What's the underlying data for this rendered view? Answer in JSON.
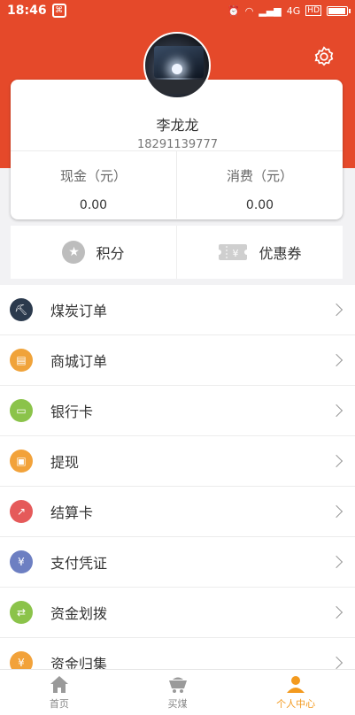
{
  "status_bar": {
    "time": "18:46",
    "network": "4G",
    "hd": "HD"
  },
  "profile": {
    "name": "李龙龙",
    "phone": "18291139777"
  },
  "stats": [
    {
      "label": "现金（元）",
      "value": "0.00"
    },
    {
      "label": "消费（元）",
      "value": "0.00"
    }
  ],
  "actions": [
    {
      "label": "积分",
      "icon": "star-icon"
    },
    {
      "label": "优惠券",
      "icon": "coupon-icon"
    }
  ],
  "menu": [
    {
      "label": "煤炭订单",
      "icon": "coal-order-icon",
      "color": "#2b3a4d"
    },
    {
      "label": "商城订单",
      "icon": "mall-order-icon",
      "color": "#f0a33a"
    },
    {
      "label": "银行卡",
      "icon": "bank-card-icon",
      "color": "#8bc34a"
    },
    {
      "label": "提现",
      "icon": "withdraw-icon",
      "color": "#f2a23a"
    },
    {
      "label": "结算卡",
      "icon": "settlement-card-icon",
      "color": "#e55a5a"
    },
    {
      "label": "支付凭证",
      "icon": "payment-voucher-icon",
      "color": "#6d7fc2"
    },
    {
      "label": "资金划拨",
      "icon": "fund-transfer-icon",
      "color": "#8bc34a"
    },
    {
      "label": "资金归集",
      "icon": "fund-collection-icon",
      "color": "#f2a23a"
    }
  ],
  "tabs": [
    {
      "label": "首页",
      "icon": "home-icon"
    },
    {
      "label": "买煤",
      "icon": "cart-icon"
    },
    {
      "label": "个人中心",
      "icon": "user-icon"
    }
  ],
  "colors": {
    "brand_red": "#e5492a",
    "active_tab": "#f39a1f"
  }
}
